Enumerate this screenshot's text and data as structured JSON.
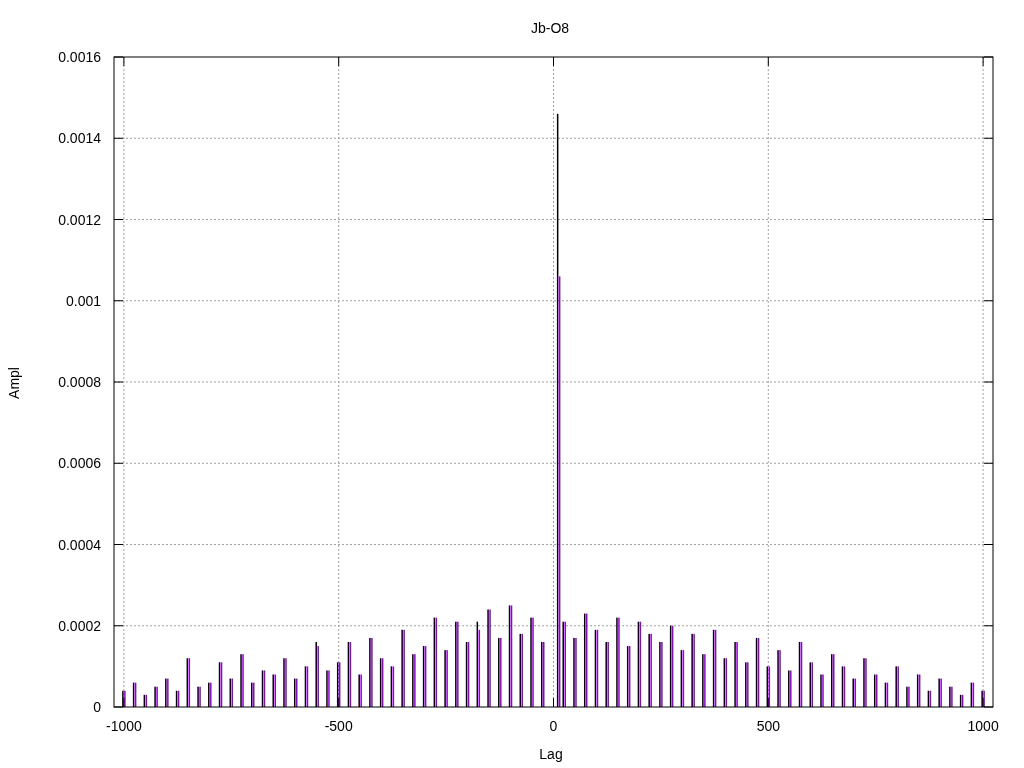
{
  "chart_data": {
    "type": "bar",
    "title": "Jb-O8",
    "xlabel": "Lag",
    "ylabel": "Ampl",
    "x": [
      -1000,
      -975,
      -950,
      -925,
      -900,
      -875,
      -850,
      -825,
      -800,
      -775,
      -750,
      -725,
      -700,
      -675,
      -650,
      -625,
      -600,
      -575,
      -550,
      -525,
      -500,
      -475,
      -450,
      -425,
      -400,
      -375,
      -350,
      -325,
      -300,
      -275,
      -250,
      -225,
      -200,
      -175,
      -150,
      -125,
      -100,
      -75,
      -50,
      -25,
      12,
      25,
      50,
      75,
      100,
      125,
      150,
      175,
      200,
      225,
      250,
      275,
      300,
      325,
      350,
      375,
      400,
      425,
      450,
      475,
      500,
      525,
      550,
      575,
      600,
      625,
      650,
      675,
      700,
      725,
      750,
      775,
      800,
      825,
      850,
      875,
      900,
      925,
      950,
      975,
      1000
    ],
    "series": [
      {
        "color": "#000000",
        "values": [
          4e-05,
          6e-05,
          3e-05,
          5e-05,
          7e-05,
          4e-05,
          0.00012,
          5e-05,
          6e-05,
          0.00011,
          7e-05,
          0.00013,
          6e-05,
          9e-05,
          8e-05,
          0.00012,
          7e-05,
          0.0001,
          0.00016,
          9e-05,
          0.00011,
          0.00016,
          8e-05,
          0.00017,
          0.00012,
          0.0001,
          0.00019,
          0.00013,
          0.00015,
          0.00022,
          0.00014,
          0.00021,
          0.00016,
          0.00021,
          0.00024,
          0.00017,
          0.00025,
          0.00018,
          0.00022,
          0.00016,
          0.00146,
          0.00021,
          0.00017,
          0.00023,
          0.00019,
          0.00016,
          0.00022,
          0.00015,
          0.00021,
          0.00018,
          0.00016,
          0.0002,
          0.00014,
          0.00018,
          0.00013,
          0.00019,
          0.00012,
          0.00016,
          0.00011,
          0.00017,
          0.0001,
          0.00014,
          9e-05,
          0.00016,
          0.00011,
          8e-05,
          0.00013,
          0.0001,
          7e-05,
          0.00012,
          8e-05,
          6e-05,
          0.0001,
          5e-05,
          8e-05,
          4e-05,
          7e-05,
          5e-05,
          3e-05,
          6e-05,
          4e-05
        ]
      },
      {
        "color": "#9400d3",
        "values": [
          4e-05,
          6e-05,
          3e-05,
          5e-05,
          7e-05,
          4e-05,
          0.00012,
          5e-05,
          6e-05,
          0.00011,
          7e-05,
          0.00013,
          6e-05,
          9e-05,
          8e-05,
          0.00012,
          7e-05,
          0.0001,
          0.00015,
          9e-05,
          0.00011,
          0.00016,
          8e-05,
          0.00017,
          0.00012,
          0.0001,
          0.00019,
          0.00013,
          0.00015,
          0.00022,
          0.00014,
          0.00021,
          0.00016,
          0.00019,
          0.00024,
          0.00017,
          0.00025,
          0.00018,
          0.00022,
          0.00016,
          0.00106,
          0.00021,
          0.00017,
          0.00023,
          0.00019,
          0.00016,
          0.00022,
          0.00015,
          0.00021,
          0.00018,
          0.00016,
          0.0002,
          0.00014,
          0.00018,
          0.00013,
          0.00019,
          0.00012,
          0.00016,
          0.00011,
          0.00017,
          0.0001,
          0.00014,
          9e-05,
          0.00016,
          0.00011,
          8e-05,
          0.00013,
          0.0001,
          7e-05,
          0.00012,
          8e-05,
          6e-05,
          0.0001,
          5e-05,
          8e-05,
          4e-05,
          7e-05,
          5e-05,
          3e-05,
          6e-05,
          4e-05
        ]
      }
    ],
    "grid": true,
    "xlim": [
      -1023,
      1023
    ],
    "ylim": [
      0,
      0.0016
    ],
    "xticks": [
      -1000,
      -500,
      0,
      500,
      1000
    ],
    "yticks": [
      {
        "value": 0,
        "label": "0"
      },
      {
        "value": 0.0002,
        "label": "0.0002"
      },
      {
        "value": 0.0004,
        "label": "0.0004"
      },
      {
        "value": 0.0006,
        "label": "0.0006"
      },
      {
        "value": 0.0008,
        "label": "0.0008"
      },
      {
        "value": 0.001,
        "label": "0.001"
      },
      {
        "value": 0.0012,
        "label": "0.0012"
      },
      {
        "value": 0.0014,
        "label": "0.0014"
      },
      {
        "value": 0.0016,
        "label": "0.0016"
      }
    ]
  }
}
